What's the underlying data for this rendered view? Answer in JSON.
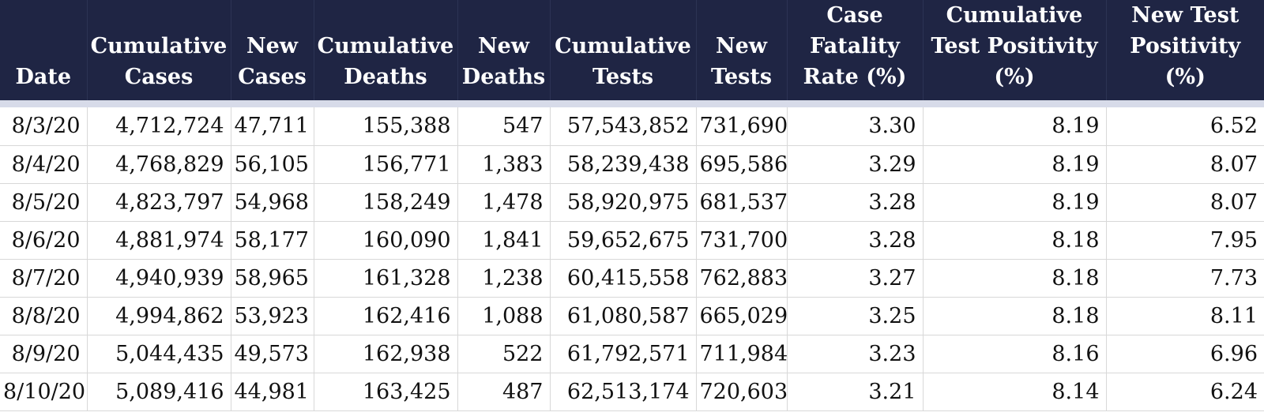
{
  "columns": [
    "Date",
    "Cumulative Cases",
    "New Cases",
    "Cumulative Deaths",
    "New Deaths",
    "Cumulative Tests",
    "New Tests",
    "Case Fatality Rate (%)",
    "Cumulative Test Positivity (%)",
    "New Test Positivity (%)"
  ],
  "rows": [
    [
      "8/3/20",
      "4,712,724",
      "47,711",
      "155,388",
      "547",
      "57,543,852",
      "731,690",
      "3.30",
      "8.19",
      "6.52"
    ],
    [
      "8/4/20",
      "4,768,829",
      "56,105",
      "156,771",
      "1,383",
      "58,239,438",
      "695,586",
      "3.29",
      "8.19",
      "8.07"
    ],
    [
      "8/5/20",
      "4,823,797",
      "54,968",
      "158,249",
      "1,478",
      "58,920,975",
      "681,537",
      "3.28",
      "8.19",
      "8.07"
    ],
    [
      "8/6/20",
      "4,881,974",
      "58,177",
      "160,090",
      "1,841",
      "59,652,675",
      "731,700",
      "3.28",
      "8.18",
      "7.95"
    ],
    [
      "8/7/20",
      "4,940,939",
      "58,965",
      "161,328",
      "1,238",
      "60,415,558",
      "762,883",
      "3.27",
      "8.18",
      "7.73"
    ],
    [
      "8/8/20",
      "4,994,862",
      "53,923",
      "162,416",
      "1,088",
      "61,080,587",
      "665,029",
      "3.25",
      "8.18",
      "8.11"
    ],
    [
      "8/9/20",
      "5,044,435",
      "49,573",
      "162,938",
      "522",
      "61,792,571",
      "711,984",
      "3.23",
      "8.16",
      "6.96"
    ],
    [
      "8/10/20",
      "5,089,416",
      "44,981",
      "163,425",
      "487",
      "62,513,174",
      "720,603",
      "3.21",
      "8.14",
      "6.24"
    ]
  ],
  "colors": {
    "header_bg": "#1f2544",
    "header_text": "#ffffff",
    "header_underline": "#d7dbe9",
    "grid_line": "#d8d8d8"
  }
}
